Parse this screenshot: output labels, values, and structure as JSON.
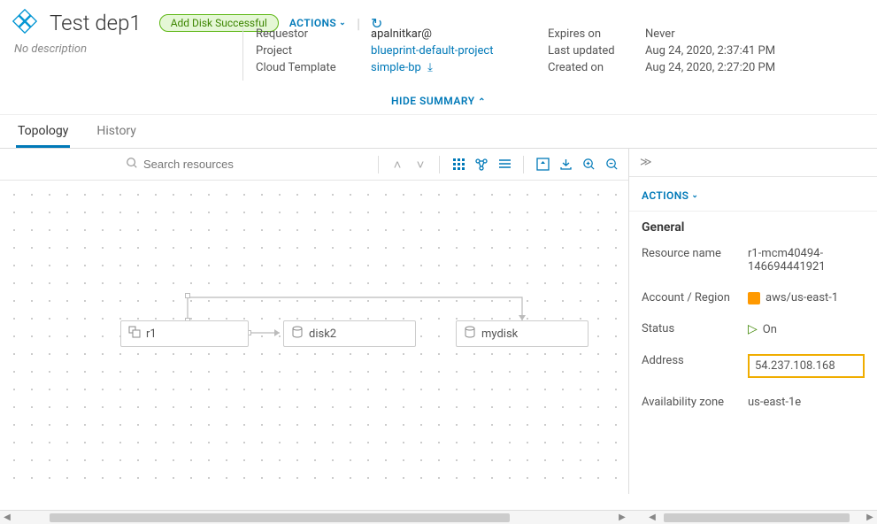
{
  "header": {
    "title": "Test dep1",
    "badge": "Add Disk Successful",
    "actionsLabel": "ACTIONS",
    "description": "No description"
  },
  "summary": {
    "keys": {
      "requestor": "Requestor",
      "project": "Project",
      "template": "Cloud Template"
    },
    "values": {
      "requestor": "apalnitkar@",
      "project": "blueprint-default-project",
      "template": "simple-bp"
    },
    "keys2": {
      "expires": "Expires on",
      "updated": "Last updated",
      "created": "Created on"
    },
    "values2": {
      "expires": "Never",
      "updated": "Aug 24, 2020, 2:37:41 PM",
      "created": "Aug 24, 2020, 2:27:20 PM"
    },
    "hideLabel": "HIDE SUMMARY"
  },
  "tabs": {
    "topology": "Topology",
    "history": "History"
  },
  "toolbar": {
    "searchPlaceholder": "Search resources"
  },
  "nodes": {
    "r1": "r1",
    "disk2": "disk2",
    "mydisk": "mydisk"
  },
  "sidepanel": {
    "actionsLabel": "ACTIONS",
    "generalTitle": "General",
    "rows": {
      "resourceName": {
        "k": "Resource name",
        "v": "r1-mcm40494-146694441921"
      },
      "accountRegion": {
        "k": "Account / Region",
        "v": "aws/us-east-1"
      },
      "status": {
        "k": "Status",
        "v": "On"
      },
      "address": {
        "k": "Address",
        "v": "54.237.108.168"
      },
      "az": {
        "k": "Availability zone",
        "v": "us-east-1e"
      }
    }
  }
}
